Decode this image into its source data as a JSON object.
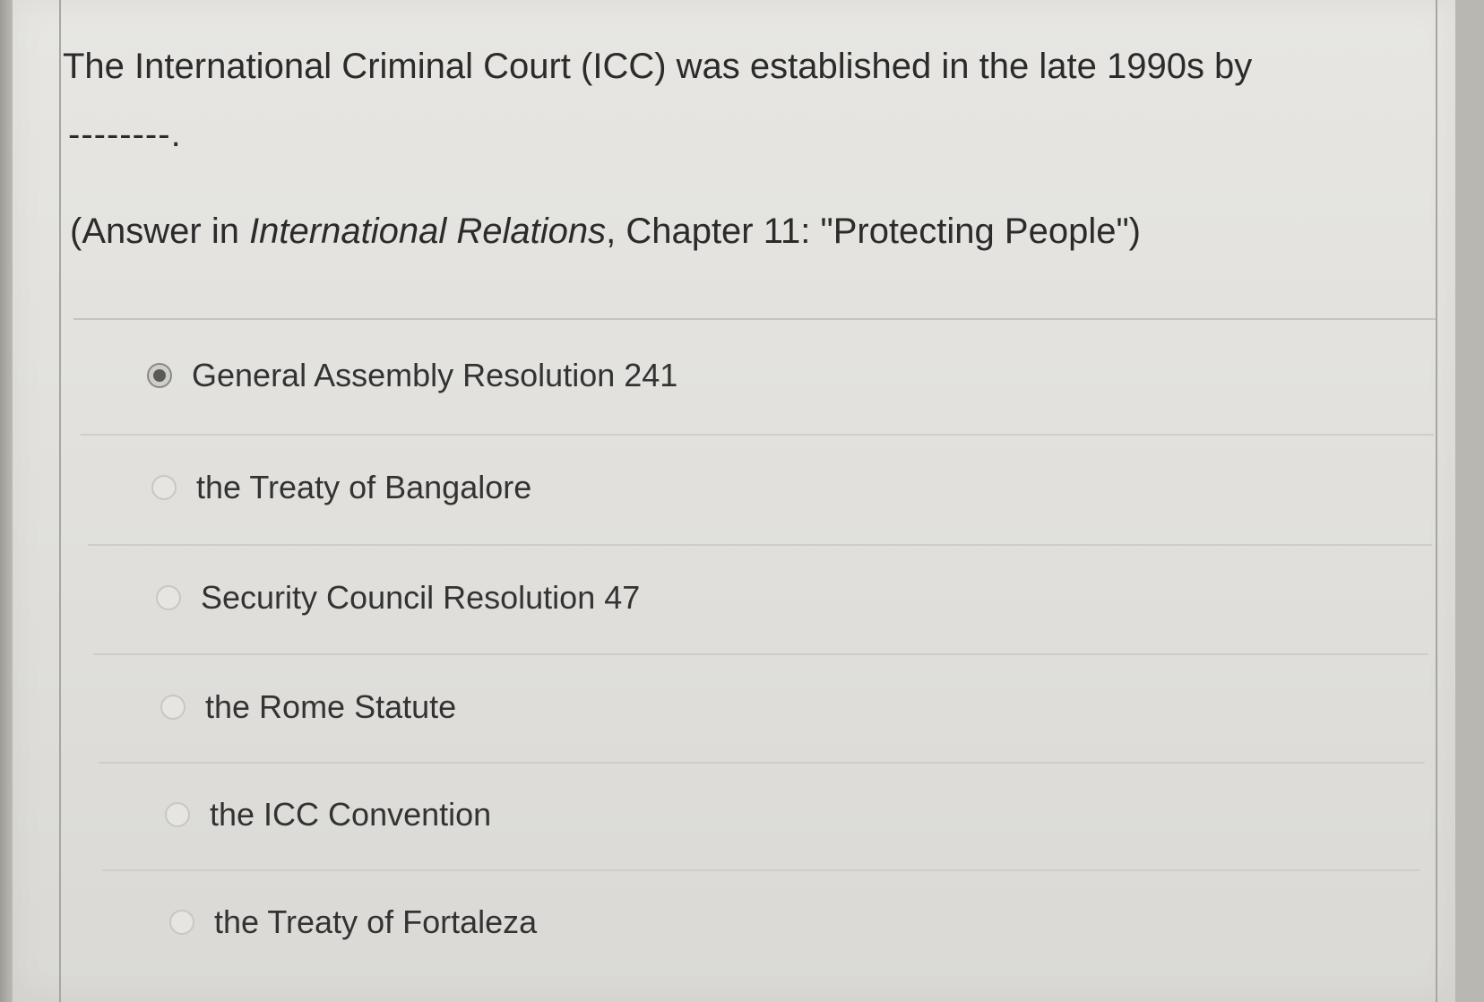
{
  "question": {
    "text": "The International Criminal Court (ICC) was established in the late 1990s by",
    "blank": "--------.",
    "reference_prefix": "(Answer in ",
    "reference_book": "International Relations",
    "reference_suffix": ", Chapter 11: \"Protecting People\")"
  },
  "options": [
    {
      "label": "General Assembly Resolution 241",
      "selected": true
    },
    {
      "label": "the Treaty of Bangalore",
      "selected": false
    },
    {
      "label": "Security Council Resolution 47",
      "selected": false
    },
    {
      "label": "the Rome Statute",
      "selected": false
    },
    {
      "label": "the ICC Convention",
      "selected": false
    },
    {
      "label": "the Treaty of Fortaleza",
      "selected": false
    }
  ]
}
